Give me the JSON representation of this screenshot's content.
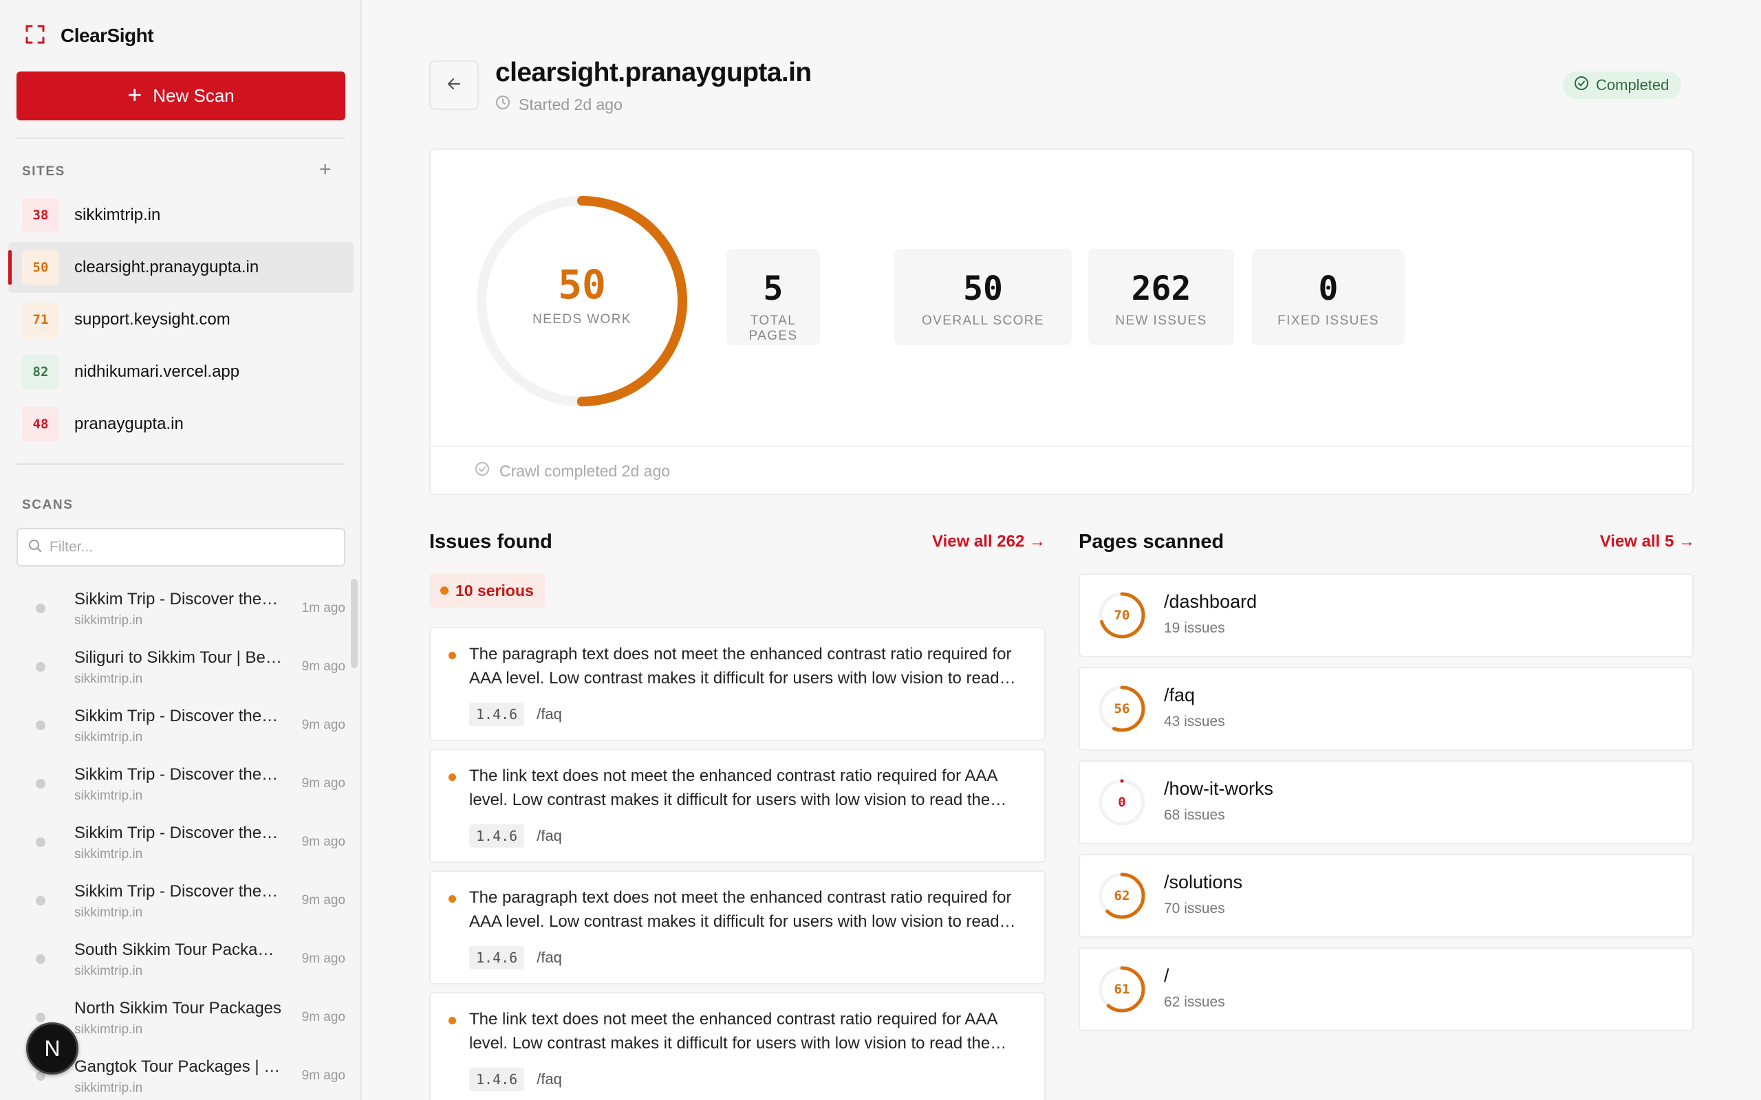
{
  "brand": {
    "name": "ClearSight",
    "logo_icon": "scan-frame-icon",
    "accent": "#d1121f"
  },
  "sidebar": {
    "new_scan_label": "New Scan",
    "sites_label": "SITES",
    "scans_label": "SCANS",
    "filter_placeholder": "Filter...",
    "sites": [
      {
        "score": "38",
        "name": "sikkimtrip.in",
        "level": "red"
      },
      {
        "score": "50",
        "name": "clearsight.pranaygupta.in",
        "level": "orange",
        "active": true
      },
      {
        "score": "71",
        "name": "support.keysight.com",
        "level": "orange"
      },
      {
        "score": "82",
        "name": "nidhikumari.vercel.app",
        "level": "green"
      },
      {
        "score": "48",
        "name": "pranaygupta.in",
        "level": "red"
      }
    ],
    "scans": [
      {
        "title": "Sikkim Trip - Discover the Magic of Sikkim",
        "site": "sikkimtrip.in",
        "time": "1m ago"
      },
      {
        "title": "Siliguri to Sikkim Tour | Best Packages",
        "site": "sikkimtrip.in",
        "time": "9m ago"
      },
      {
        "title": "Sikkim Trip - Discover the Magic of Sikkim",
        "site": "sikkimtrip.in",
        "time": "9m ago"
      },
      {
        "title": "Sikkim Trip - Discover the Magic of Sikkim",
        "site": "sikkimtrip.in",
        "time": "9m ago"
      },
      {
        "title": "Sikkim Trip - Discover the Magic of Sikkim",
        "site": "sikkimtrip.in",
        "time": "9m ago"
      },
      {
        "title": "Sikkim Trip - Discover the Magic of Sikkim",
        "site": "sikkimtrip.in",
        "time": "9m ago"
      },
      {
        "title": "South Sikkim Tour Packages",
        "site": "sikkimtrip.in",
        "time": "9m ago"
      },
      {
        "title": "North Sikkim Tour Packages",
        "site": "sikkimtrip.in",
        "time": "9m ago"
      },
      {
        "title": "Gangtok Tour Packages | Sikkim",
        "site": "sikkimtrip.in",
        "time": "9m ago"
      }
    ],
    "dev_badge": "N"
  },
  "header": {
    "title": "clearsight.pranaygupta.in",
    "started": "Started 2d ago",
    "status": "Completed"
  },
  "summary": {
    "score": "50",
    "score_fraction": 0.5,
    "score_label": "NEEDS WORK",
    "stats": [
      {
        "value": "5",
        "label": "TOTAL PAGES"
      },
      {
        "value": "50",
        "label": "OVERALL SCORE"
      },
      {
        "value": "262",
        "label": "NEW ISSUES"
      },
      {
        "value": "0",
        "label": "FIXED ISSUES"
      }
    ],
    "footer": "Crawl completed 2d ago"
  },
  "issues": {
    "title": "Issues found",
    "view_all": "View all 262 →",
    "serious": "10 serious",
    "items": [
      {
        "text": "The paragraph text does not meet the enhanced contrast ratio required for AAA level. Low contrast makes it difficult for users with low vision to read the content.",
        "code": "1.4.6",
        "path": "/faq"
      },
      {
        "text": "The link text does not meet the enhanced contrast ratio required for AAA level. Low contrast makes it difficult for users with low vision to read the content.",
        "code": "1.4.6",
        "path": "/faq"
      },
      {
        "text": "The paragraph text does not meet the enhanced contrast ratio required for AAA level. Low contrast makes it difficult for users with low vision to read the content.",
        "code": "1.4.6",
        "path": "/faq"
      },
      {
        "text": "The link text does not meet the enhanced contrast ratio required for AAA level. Low contrast makes it difficult for users with low vision to read the content.",
        "code": "1.4.6",
        "path": "/faq"
      }
    ]
  },
  "pages": {
    "title": "Pages scanned",
    "view_all": "View all 5 →",
    "items": [
      {
        "score": "70",
        "fraction": 0.7,
        "path": "/dashboard",
        "issues": "19 issues",
        "color": "#d76f0c"
      },
      {
        "score": "56",
        "fraction": 0.56,
        "path": "/faq",
        "issues": "43 issues",
        "color": "#d76f0c"
      },
      {
        "score": "0",
        "fraction": 0,
        "path": "/how-it-works",
        "issues": "68 issues",
        "color": "#d1121f"
      },
      {
        "score": "62",
        "fraction": 0.62,
        "path": "/solutions",
        "issues": "70 issues",
        "color": "#d76f0c"
      },
      {
        "score": "61",
        "fraction": 0.61,
        "path": "/",
        "issues": "62 issues",
        "color": "#d76f0c"
      }
    ]
  }
}
